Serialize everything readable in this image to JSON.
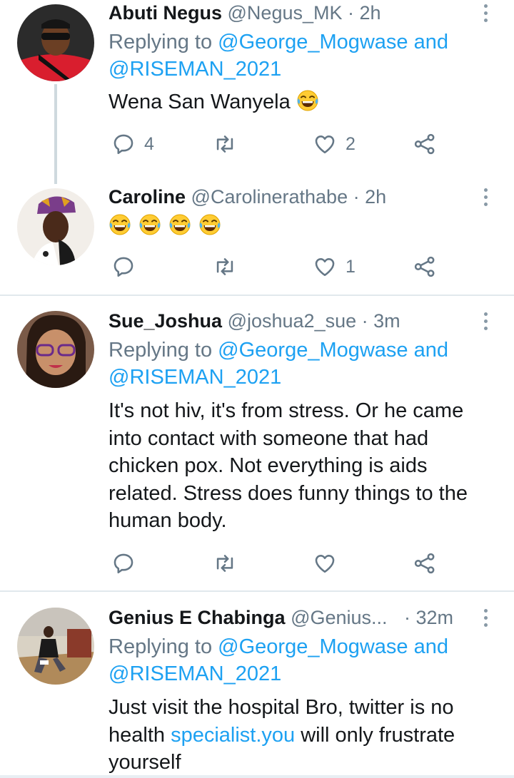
{
  "tweets": [
    {
      "name": "Abuti Negus",
      "handle": "@Negus_MK",
      "separator": "·",
      "time": "2h",
      "replying_label": "Replying to",
      "replying_to": "@George_Mogwase and",
      "replying_to2": "@RISEMAN_2021",
      "text": "Wena San Wanyela",
      "emoji": "face-with-tears-of-joy",
      "reply_count": "4",
      "retweet_count": "",
      "like_count": "2"
    },
    {
      "name": "Caroline",
      "handle": "@Carolinerathabe",
      "separator": "·",
      "time": "2h",
      "emoji_text": [
        "face-with-tears-of-joy",
        "face-with-tears-of-joy",
        "face-with-tears-of-joy",
        "face-with-tears-of-joy"
      ],
      "reply_count": "",
      "retweet_count": "",
      "like_count": "1"
    },
    {
      "name": "Sue_Joshua",
      "handle": "@joshua2_sue",
      "separator": "·",
      "time": "3m",
      "replying_label": "Replying to",
      "replying_to": "@George_Mogwase and",
      "replying_to2": "@RISEMAN_2021",
      "lines": [
        "It's not hiv, it's from stress. Or he came",
        "into contact with someone that had",
        "chicken pox. Not everything is aids",
        "related. Stress does funny things to the",
        "human body."
      ],
      "reply_count": "",
      "retweet_count": "",
      "like_count": ""
    },
    {
      "name": "Genius E Chabinga",
      "handle": "@Genius...",
      "separator": "·",
      "time": "32m",
      "replying_label": "Replying to",
      "replying_to": "@George_Mogwase and",
      "replying_to2": "@RISEMAN_2021",
      "line1": "Just visit the hospital Bro, twitter is no",
      "line2_pre": "health ",
      "line2_link": "specialist.you",
      "line2_post": " will only frustrate",
      "line3": "yourself"
    }
  ],
  "colors": {
    "link": "#1da1f2",
    "secondary": "#657786",
    "divider": "#e1e8ed",
    "thread_line": "#cfd9de"
  }
}
